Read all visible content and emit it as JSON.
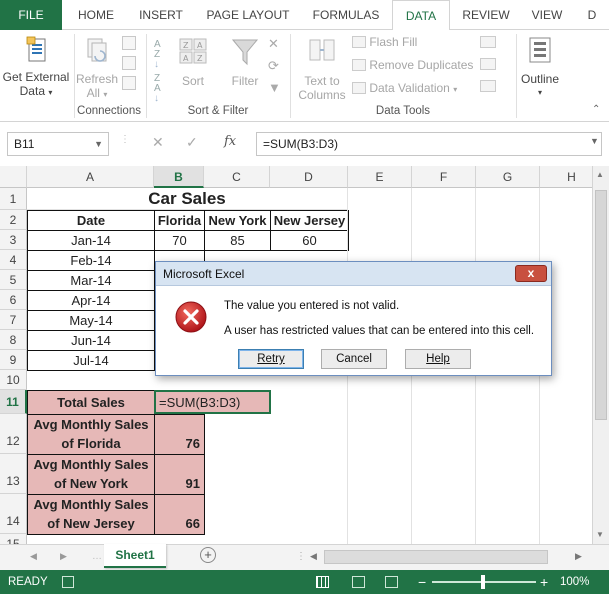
{
  "ribbon": {
    "tabs": [
      "FILE",
      "HOME",
      "INSERT",
      "PAGE LAYOUT",
      "FORMULAS",
      "DATA",
      "REVIEW",
      "VIEW",
      "D"
    ],
    "active_tab": "DATA",
    "get_external_data": "Get External Data",
    "get_external_data_line1": "Get External",
    "get_external_data_line2": "Data",
    "refresh_all_line1": "Refresh",
    "refresh_all_line2": "All",
    "sort": "Sort",
    "filter": "Filter",
    "text_to_columns_line1": "Text to",
    "text_to_columns_line2": "Columns",
    "flash_fill": "Flash Fill",
    "remove_duplicates": "Remove Duplicates",
    "data_validation": "Data Validation",
    "outline": "Outline",
    "groups": {
      "connections": "Connections",
      "sort_filter": "Sort & Filter",
      "data_tools": "Data Tools"
    }
  },
  "formula_bar": {
    "name_box": "B11",
    "fx": "fx",
    "formula": "=SUM(B3:D3)"
  },
  "sheet": {
    "columns": [
      "A",
      "B",
      "C",
      "D",
      "E",
      "F",
      "G",
      "H"
    ],
    "rows": [
      "1",
      "2",
      "3",
      "4",
      "5",
      "6",
      "7",
      "8",
      "9",
      "10",
      "11",
      "12",
      "13",
      "14",
      "15"
    ],
    "title": "Car Sales",
    "headers": {
      "date": "Date",
      "florida": "Florida",
      "new_york": "New York",
      "new_jersey": "New Jersey"
    },
    "dates": [
      "Jan-14",
      "Feb-14",
      "Mar-14",
      "Apr-14",
      "May-14",
      "Jun-14",
      "Jul-14"
    ],
    "row3": {
      "florida": "70",
      "new_york": "85",
      "new_jersey": "60"
    },
    "total_sales_label": "Total Sales",
    "total_sales_formula": "=SUM(B3:D3)",
    "avg_florida_l1": "Avg Monthly Sales",
    "avg_florida_l2": "of Florida",
    "avg_florida_val": "76",
    "avg_ny_l1": "Avg Monthly Sales",
    "avg_ny_l2": "of New York",
    "avg_ny_val": "91",
    "avg_nj_l1": "Avg Monthly Sales",
    "avg_nj_l2": "of New Jersey",
    "avg_nj_val": "66"
  },
  "sheet_tabs": {
    "active": "Sheet1"
  },
  "status": {
    "ready": "READY",
    "zoom": "100%"
  },
  "dialog": {
    "title": "Microsoft Excel",
    "close": "x",
    "line1": "The value you entered is not valid.",
    "line2": "A user has restricted values that can be entered into this cell.",
    "retry": "Retry",
    "cancel": "Cancel",
    "help": "Help"
  },
  "colors": {
    "excel_green": "#217346",
    "highlight_pink": "#e6b8b7",
    "error_red": "#c8102e"
  }
}
